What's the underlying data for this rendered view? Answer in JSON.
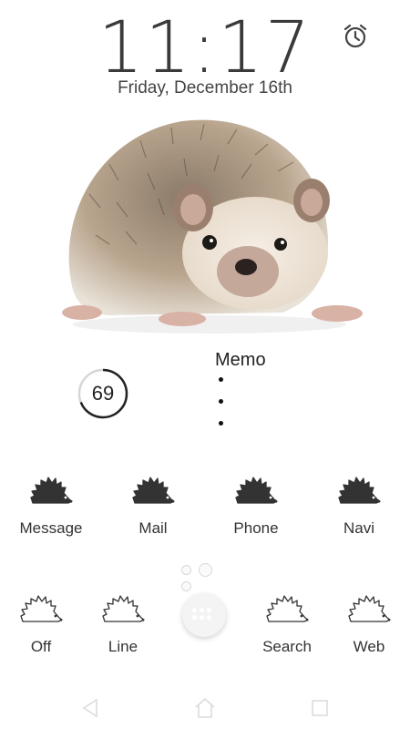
{
  "lockscreen": {
    "time": "11:17",
    "date": "Friday, December 16th"
  },
  "memo": {
    "title": "Memo"
  },
  "battery": {
    "value": "69",
    "fraction": 0.69
  },
  "shortcuts_top": [
    {
      "label": "Message",
      "icon": "hedgehog-filled-icon"
    },
    {
      "label": "Mail",
      "icon": "hedgehog-filled-icon"
    },
    {
      "label": "Phone",
      "icon": "hedgehog-filled-icon"
    },
    {
      "label": "Navi",
      "icon": "hedgehog-filled-icon"
    }
  ],
  "shortcuts_bottom": [
    {
      "label": "Off",
      "icon": "hedgehog-outline-icon"
    },
    {
      "label": "Line",
      "icon": "hedgehog-outline-icon"
    },
    {
      "label": "Search",
      "icon": "hedgehog-outline-icon"
    },
    {
      "label": "Web",
      "icon": "hedgehog-outline-icon"
    }
  ],
  "colors": {
    "background": "#ffffff",
    "icon_fill": "#333333",
    "text": "#333333"
  }
}
